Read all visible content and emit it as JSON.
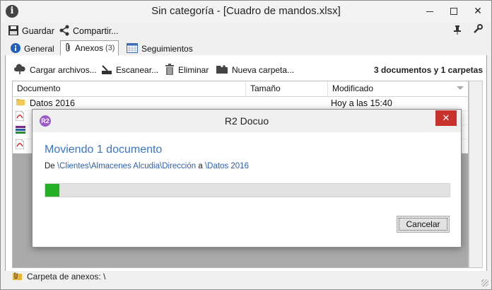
{
  "window": {
    "title": "Sin categoría - [Cuadro de mandos.xlsx]"
  },
  "toolbar": {
    "save_label": "Guardar",
    "share_label": "Compartir..."
  },
  "tabs": [
    {
      "label": "General",
      "icon": "info-icon"
    },
    {
      "label": "Anexos",
      "badge": "(3)",
      "icon": "paperclip-icon"
    },
    {
      "label": "Seguimientos",
      "icon": "calendar-icon"
    }
  ],
  "attachments_toolbar": {
    "upload_label": "Cargar archivos...",
    "scan_label": "Escanear...",
    "delete_label": "Eliminar",
    "new_folder_label": "Nueva carpeta...",
    "summary": "3 documentos y 1 carpetas"
  },
  "grid": {
    "columns": [
      "Documento",
      "Tamaño",
      "Modificado"
    ],
    "rows": [
      {
        "name": "Datos 2016",
        "size": "",
        "modified": "Hoy a las 15:40",
        "icon": "folder-icon"
      }
    ],
    "extra_row_icons": [
      "pdf-icon",
      "archive-icon",
      "pdf-icon"
    ]
  },
  "status": {
    "label": "Carpeta de anexos: \\"
  },
  "dialog": {
    "title": "R2 Docuo",
    "logo_text": "R2",
    "heading": "Moviendo 1 documento",
    "from_prefix": "De",
    "from_path": "\\Clientes\\Almacenes Alcudia\\Dirección",
    "to_prefix": "a",
    "to_path": "\\Datos 2016",
    "progress": 0.035,
    "cancel_label": "Cancelar"
  },
  "colors": {
    "accent": "#3b76c6",
    "progress": "#26b026",
    "close": "#c9312d"
  }
}
